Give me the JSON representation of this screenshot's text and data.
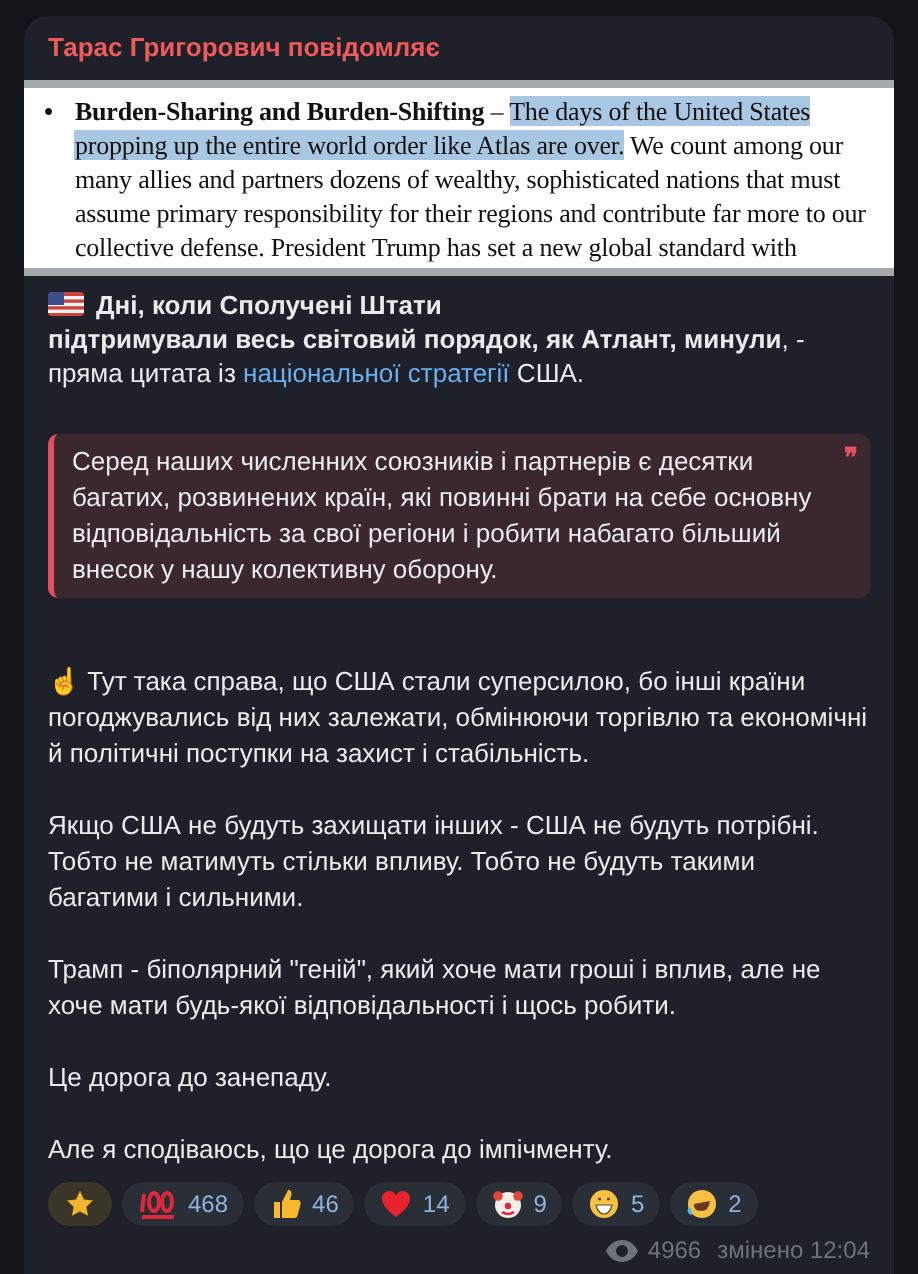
{
  "sender": "Тарас Григорович повідомляє",
  "document": {
    "bullet": "•",
    "lead": "Burden-Sharing and Burden-Shifting",
    "dash": " – ",
    "highlighted": "The days of the United States propping up the entire world order like Atlas are over.",
    "rest": " We count among our many allies and partners dozens of wealthy, sophisticated nations that must assume primary responsibility for their regions and contribute far more to our collective defense. President Trump has set a new global standard with"
  },
  "headline": {
    "bold_line1": "Дні, коли Сполучені Штати",
    "bold": "підтримували весь світовий порядок, як Атлант, минули",
    "after": ", -",
    "line2_before": "пряма цитата із ",
    "link": "національної стратегії",
    "line2_after": " США."
  },
  "quote": {
    "text": "Серед наших численних союзників і партнерів є десятки багатих, розвинених країн, які повинні брати на себе основну відповідальність за свої регіони і робити набагато більший внесок у нашу колективну оборону.",
    "mark": "❞"
  },
  "paragraphs": [
    "☝️ Тут така справа, що США стали суперсилою, бо інші країни погоджувались від них залежати, обмінюючи торгівлю та економічні й політичні поступки на захист і стабільність.",
    "Якщо США не будуть захищати інших - США не будуть потрібні. Тобто не матимуть стільки впливу. Тобто не будуть такими багатими і сильними.",
    "Трамп - біполярний \"геній\", який хоче мати гроші і вплив, але не хоче мати будь-якої відповідальності і щось робити.",
    "Це дорога до занепаду.",
    "Але я сподіваюсь, що це дорога до імпічменту."
  ],
  "reactions": [
    {
      "kind": "star",
      "selected": true
    },
    {
      "kind": "hundred",
      "count": "468",
      "selected": false
    },
    {
      "kind": "thumbs",
      "count": "46",
      "selected": false
    },
    {
      "kind": "heart",
      "count": "14",
      "selected": false
    },
    {
      "kind": "clown",
      "count": "9",
      "selected": false
    },
    {
      "kind": "grin",
      "count": "5",
      "selected": false
    },
    {
      "kind": "laugh",
      "count": "2",
      "selected": false
    }
  ],
  "views": "4966",
  "edited": "змінено 12:04"
}
